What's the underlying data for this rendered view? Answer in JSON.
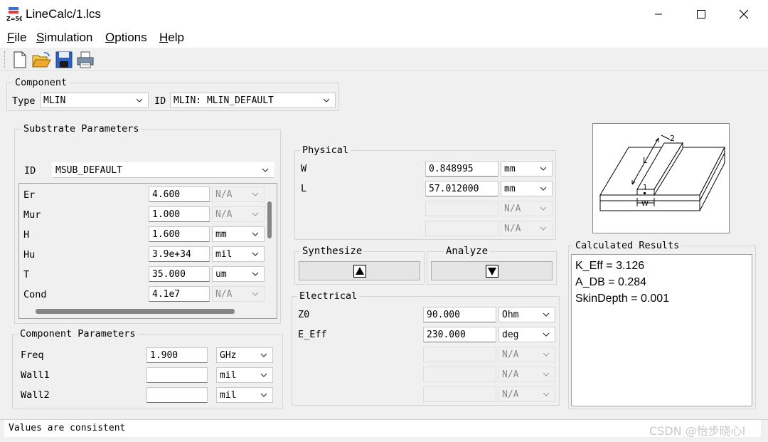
{
  "window": {
    "title": "LineCalc/1.lcs",
    "app_icon_text": "Z=50"
  },
  "menu": [
    {
      "mnemonic": "F",
      "rest": "ile"
    },
    {
      "mnemonic": "S",
      "rest": "imulation"
    },
    {
      "mnemonic": "O",
      "rest": "ptions"
    },
    {
      "mnemonic": "H",
      "rest": "elp"
    }
  ],
  "toolbar": [
    "new-file-icon",
    "open-folder-icon",
    "save-icon",
    "print-icon"
  ],
  "component": {
    "group_label": "Component",
    "type_label": "Type",
    "type_value": "MLIN",
    "id_label": "ID",
    "id_value": "MLIN: MLIN_DEFAULT"
  },
  "substrate": {
    "group_label": "Substrate Parameters",
    "id_label": "ID",
    "id_value": "MSUB_DEFAULT",
    "rows": [
      {
        "name": "Er",
        "value": "4.600",
        "unit": "N/A",
        "enabled": false
      },
      {
        "name": "Mur",
        "value": "1.000",
        "unit": "N/A",
        "enabled": false
      },
      {
        "name": "H",
        "value": "1.600",
        "unit": "mm",
        "enabled": true
      },
      {
        "name": "Hu",
        "value": "3.9e+34",
        "unit": "mil",
        "enabled": true
      },
      {
        "name": "T",
        "value": "35.000",
        "unit": "um",
        "enabled": true
      },
      {
        "name": "Cond",
        "value": "4.1e7",
        "unit": "N/A",
        "enabled": false
      }
    ]
  },
  "component_params": {
    "group_label": "Component Parameters",
    "rows": [
      {
        "name": "Freq",
        "value": "1.900",
        "unit": "GHz"
      },
      {
        "name": "Wall1",
        "value": "",
        "unit": "mil"
      },
      {
        "name": "Wall2",
        "value": "",
        "unit": "mil"
      }
    ]
  },
  "physical": {
    "group_label": "Physical",
    "rows": [
      {
        "name": "W",
        "value": "0.848995",
        "unit": "mm",
        "enabled": true
      },
      {
        "name": "L",
        "value": "57.012000",
        "unit": "mm",
        "enabled": true
      },
      {
        "name": "",
        "value": "",
        "unit": "N/A",
        "enabled": false
      },
      {
        "name": "",
        "value": "",
        "unit": "N/A",
        "enabled": false
      }
    ]
  },
  "synthesize": {
    "label": "Synthesize"
  },
  "analyze": {
    "label": "Analyze"
  },
  "electrical": {
    "group_label": "Electrical",
    "rows": [
      {
        "name": "Z0",
        "value": "90.000",
        "unit": "Ohm",
        "enabled": true
      },
      {
        "name": "E_Eff",
        "value": "230.000",
        "unit": "deg",
        "enabled": true
      },
      {
        "name": "",
        "value": "",
        "unit": "N/A",
        "enabled": false
      },
      {
        "name": "",
        "value": "",
        "unit": "N/A",
        "enabled": false
      },
      {
        "name": "",
        "value": "",
        "unit": "N/A",
        "enabled": false
      }
    ]
  },
  "diagram": {
    "label_L": "L",
    "label_W": "W",
    "label_1": "1",
    "label_2": "2"
  },
  "results": {
    "group_label": "Calculated Results",
    "lines": [
      "K_Eff = 3.126",
      "A_DB = 0.284",
      "SkinDepth = 0.001"
    ]
  },
  "status": {
    "text": "Values are consistent"
  },
  "watermark": "CSDN @怡步晓心l"
}
